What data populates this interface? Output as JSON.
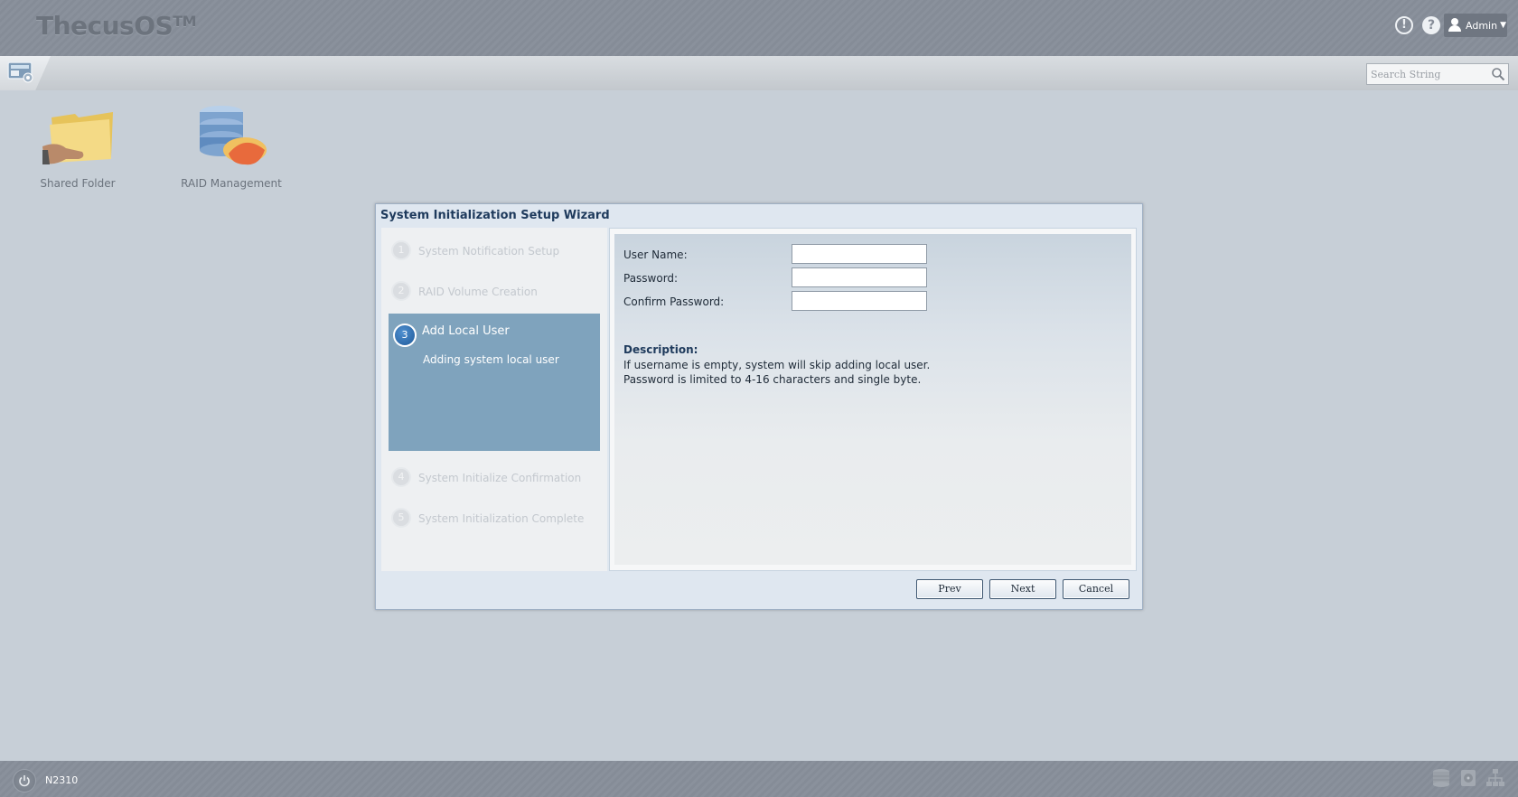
{
  "brand": {
    "name": "ThecusOS",
    "mark": "TM"
  },
  "header": {
    "alert_icon": "exclamation-circle-icon",
    "help_icon": "question-circle-icon",
    "user": {
      "name": "Admin",
      "icon": "user-icon",
      "caret": "chevron-down-icon"
    }
  },
  "search": {
    "placeholder": "Search String"
  },
  "desktop": {
    "items": [
      {
        "label": "Shared Folder",
        "icon": "shared-folder-icon"
      },
      {
        "label": "RAID Management",
        "icon": "raid-management-icon"
      }
    ]
  },
  "wizard": {
    "title": "System Initialization Setup Wizard",
    "steps": [
      {
        "num": "1",
        "label": "System Notification Setup"
      },
      {
        "num": "2",
        "label": "RAID Volume Creation"
      },
      {
        "num": "3",
        "label": "Add Local User",
        "sub": "Adding system local user",
        "active": true
      },
      {
        "num": "4",
        "label": "System Initialize Confirmation"
      },
      {
        "num": "5",
        "label": "System Initialization Complete"
      }
    ],
    "form": {
      "username_label": "User Name:",
      "username_value": "",
      "password_label": "Password:",
      "password_value": "",
      "confirm_label": "Confirm Password:",
      "confirm_value": ""
    },
    "description": {
      "title": "Description:",
      "lines": [
        "If username is empty, system will skip adding local user.",
        "Password is limited to 4-16 characters and single byte."
      ]
    },
    "buttons": {
      "prev": "Prev",
      "next": "Next",
      "cancel": "Cancel"
    }
  },
  "footer": {
    "model": "N2310",
    "power_icon": "power-icon",
    "tray_icons": [
      "storage-icon",
      "disk-icon",
      "network-icon"
    ]
  },
  "colors": {
    "desktop_bg": "#c7cfd7",
    "topbar": "#878e99",
    "active_step": "#7fa3bd",
    "dialog_title": "#1e3a5c"
  }
}
